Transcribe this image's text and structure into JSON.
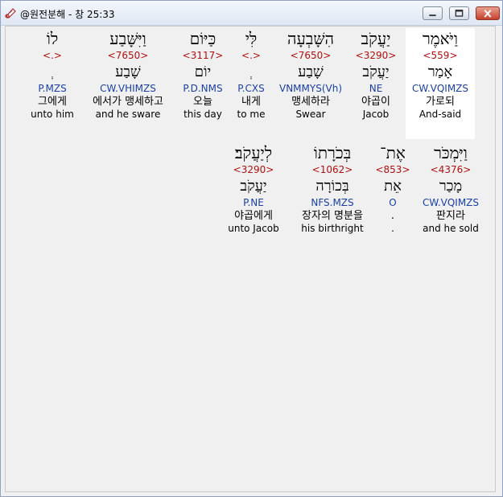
{
  "window": {
    "title": "@원전분해 - 창 25:33"
  },
  "colors": {
    "strong": "#b01010",
    "morph": "#1a3fa8",
    "highlight": "#ffffff"
  },
  "icons": {
    "app": "scroll-icon",
    "minimize": "minimize-icon",
    "maximize": "maximize-icon",
    "close": "close-icon"
  },
  "words": [
    {
      "heb": "וַיֹּאמֶר",
      "strong": "<559>",
      "lemma": "אָמַר",
      "morph": "CW.VQIMZS",
      "kor": "가로되",
      "eng": "And-said",
      "highlighted": true
    },
    {
      "heb": "יַעֲקֹב",
      "strong": "<3290>",
      "lemma": "יַעֲקֹב",
      "morph": "NE",
      "kor": "야곱이",
      "eng": "Jacob"
    },
    {
      "heb": "הִשָּׁבְעָה",
      "strong": "<7650>",
      "lemma": "שָׁבַע",
      "morph": "VNMMYS(Vh)",
      "kor": "맹세하라",
      "eng": "Swear"
    },
    {
      "heb": "לִּי",
      "strong": "<.>",
      "lemma": "ְ",
      "morph": "P.CXS",
      "kor": "내게",
      "eng": "to me"
    },
    {
      "heb": "כַּיּוֹם",
      "strong": "<3117>",
      "lemma": "יוֹם",
      "morph": "P.D.NMS",
      "kor": "오늘",
      "eng": "this day"
    },
    {
      "heb": "וַיִּשָּׁבַע",
      "strong": "<7650>",
      "lemma": "שָׁבַע",
      "morph": "CW.VHIMZS",
      "kor": "에서가 맹세하고",
      "eng": "and he sware"
    },
    {
      "heb": "לוֹ",
      "strong": "<.>",
      "lemma": "ְ",
      "morph": "P.MZS",
      "kor": "그에게",
      "eng": "unto him"
    },
    {
      "heb": "וַיִּמְכֹּר",
      "strong": "<4376>",
      "lemma": "מָכַר",
      "morph": "CW.VQIMZS",
      "kor": "판지라",
      "eng": "and he sold"
    },
    {
      "heb": "אֶת־",
      "strong": "<853>",
      "lemma": "אֵת",
      "morph": "O",
      "kor": ".",
      "eng": "."
    },
    {
      "heb": "בְּכֹרָתוֹ",
      "strong": "<1062>",
      "lemma": "בְּכוֹרָה",
      "morph": "NFS.MZS",
      "kor": "장자의 명분을",
      "eng": "his birthright"
    },
    {
      "heb": "לְיַעֲקֹב׃",
      "strong": "<3290>",
      "lemma": "יַעֲקֹב",
      "morph": "P.NE",
      "kor": "야곱에게",
      "eng": "unto Jacob"
    }
  ]
}
